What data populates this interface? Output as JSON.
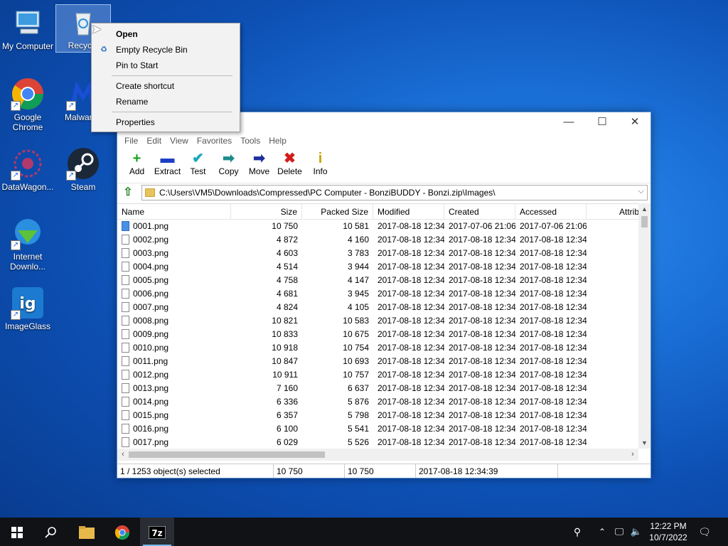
{
  "desktop": {
    "icons": [
      {
        "label": "My Computer"
      },
      {
        "label": "Recycle"
      },
      {
        "label": "Google Chrome"
      },
      {
        "label": "Malwareb"
      },
      {
        "label": "DataWagon..."
      },
      {
        "label": "Steam"
      },
      {
        "label": "Internet Downlo..."
      },
      {
        "label": "ImageGlass"
      }
    ]
  },
  "context_menu": {
    "items": [
      "Open",
      "Empty Recycle Bin",
      "Pin to Start",
      "Create shortcut",
      "Rename",
      "Properties"
    ]
  },
  "window": {
    "controls": {
      "minimize": "—",
      "maximize": "☐",
      "close": "✕"
    },
    "menu": [
      "File",
      "Edit",
      "View",
      "Favorites",
      "Tools",
      "Help"
    ],
    "toolbar": [
      {
        "label": "Add",
        "icon": "+",
        "color": "#1fa21f"
      },
      {
        "label": "Extract",
        "icon": "▬",
        "color": "#1d3fc4"
      },
      {
        "label": "Test",
        "icon": "✔",
        "color": "#18a9b8"
      },
      {
        "label": "Copy",
        "icon": "➡",
        "color": "#1f8c8c"
      },
      {
        "label": "Move",
        "icon": "➡",
        "color": "#1c2f9e"
      },
      {
        "label": "Delete",
        "icon": "✖",
        "color": "#d41b1b"
      },
      {
        "label": "Info",
        "icon": "i",
        "color": "#c9a400"
      }
    ],
    "address": "C:\\Users\\VM5\\Downloads\\Compressed\\PC Computer - BonziBUDDY - Bonzi.zip\\Images\\",
    "columns": [
      "Name",
      "Size",
      "Packed Size",
      "Modified",
      "Created",
      "Accessed",
      "Attrib"
    ],
    "rows": [
      [
        "0001.png",
        "10 750",
        "10 581",
        "2017-08-18 12:34",
        "2017-07-06 21:06",
        "2017-07-06 21:06"
      ],
      [
        "0002.png",
        "4 872",
        "4 160",
        "2017-08-18 12:34",
        "2017-08-18 12:34",
        "2017-08-18 12:34"
      ],
      [
        "0003.png",
        "4 603",
        "3 783",
        "2017-08-18 12:34",
        "2017-08-18 12:34",
        "2017-08-18 12:34"
      ],
      [
        "0004.png",
        "4 514",
        "3 944",
        "2017-08-18 12:34",
        "2017-08-18 12:34",
        "2017-08-18 12:34"
      ],
      [
        "0005.png",
        "4 758",
        "4 147",
        "2017-08-18 12:34",
        "2017-08-18 12:34",
        "2017-08-18 12:34"
      ],
      [
        "0006.png",
        "4 681",
        "3 945",
        "2017-08-18 12:34",
        "2017-08-18 12:34",
        "2017-08-18 12:34"
      ],
      [
        "0007.png",
        "4 824",
        "4 105",
        "2017-08-18 12:34",
        "2017-08-18 12:34",
        "2017-08-18 12:34"
      ],
      [
        "0008.png",
        "10 821",
        "10 583",
        "2017-08-18 12:34",
        "2017-08-18 12:34",
        "2017-08-18 12:34"
      ],
      [
        "0009.png",
        "10 833",
        "10 675",
        "2017-08-18 12:34",
        "2017-08-18 12:34",
        "2017-08-18 12:34"
      ],
      [
        "0010.png",
        "10 918",
        "10 754",
        "2017-08-18 12:34",
        "2017-08-18 12:34",
        "2017-08-18 12:34"
      ],
      [
        "0011.png",
        "10 847",
        "10 693",
        "2017-08-18 12:34",
        "2017-08-18 12:34",
        "2017-08-18 12:34"
      ],
      [
        "0012.png",
        "10 911",
        "10 757",
        "2017-08-18 12:34",
        "2017-08-18 12:34",
        "2017-08-18 12:34"
      ],
      [
        "0013.png",
        "7 160",
        "6 637",
        "2017-08-18 12:34",
        "2017-08-18 12:34",
        "2017-08-18 12:34"
      ],
      [
        "0014.png",
        "6 336",
        "5 876",
        "2017-08-18 12:34",
        "2017-08-18 12:34",
        "2017-08-18 12:34"
      ],
      [
        "0015.png",
        "6 357",
        "5 798",
        "2017-08-18 12:34",
        "2017-08-18 12:34",
        "2017-08-18 12:34"
      ],
      [
        "0016.png",
        "6 100",
        "5 541",
        "2017-08-18 12:34",
        "2017-08-18 12:34",
        "2017-08-18 12:34"
      ],
      [
        "0017.png",
        "6 029",
        "5 526",
        "2017-08-18 12:34",
        "2017-08-18 12:34",
        "2017-08-18 12:34"
      ]
    ],
    "status": {
      "selected": "1 / 1253 object(s) selected",
      "size": "10 750",
      "packed": "10 750",
      "modified": "2017-08-18 12:34:39"
    }
  },
  "taskbar": {
    "time": "12:22 PM",
    "date": "10/7/2022"
  }
}
